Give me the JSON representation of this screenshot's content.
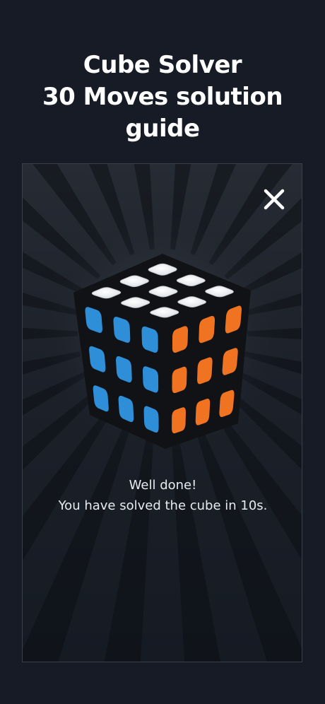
{
  "header": {
    "line1": "Cube Solver",
    "line2": "30 Moves solution",
    "line3": "guide"
  },
  "dialog": {
    "close_icon": "close-icon",
    "message_line1": "Well done!",
    "message_line2": "You have solved the cube in 10s."
  },
  "cube": {
    "faces": {
      "top": "white",
      "left": "blue",
      "right": "orange"
    }
  },
  "colors": {
    "background": "#161b26",
    "cube_white": "#f1f3f5",
    "cube_blue": "#2e8fd8",
    "cube_orange": "#f07321"
  }
}
